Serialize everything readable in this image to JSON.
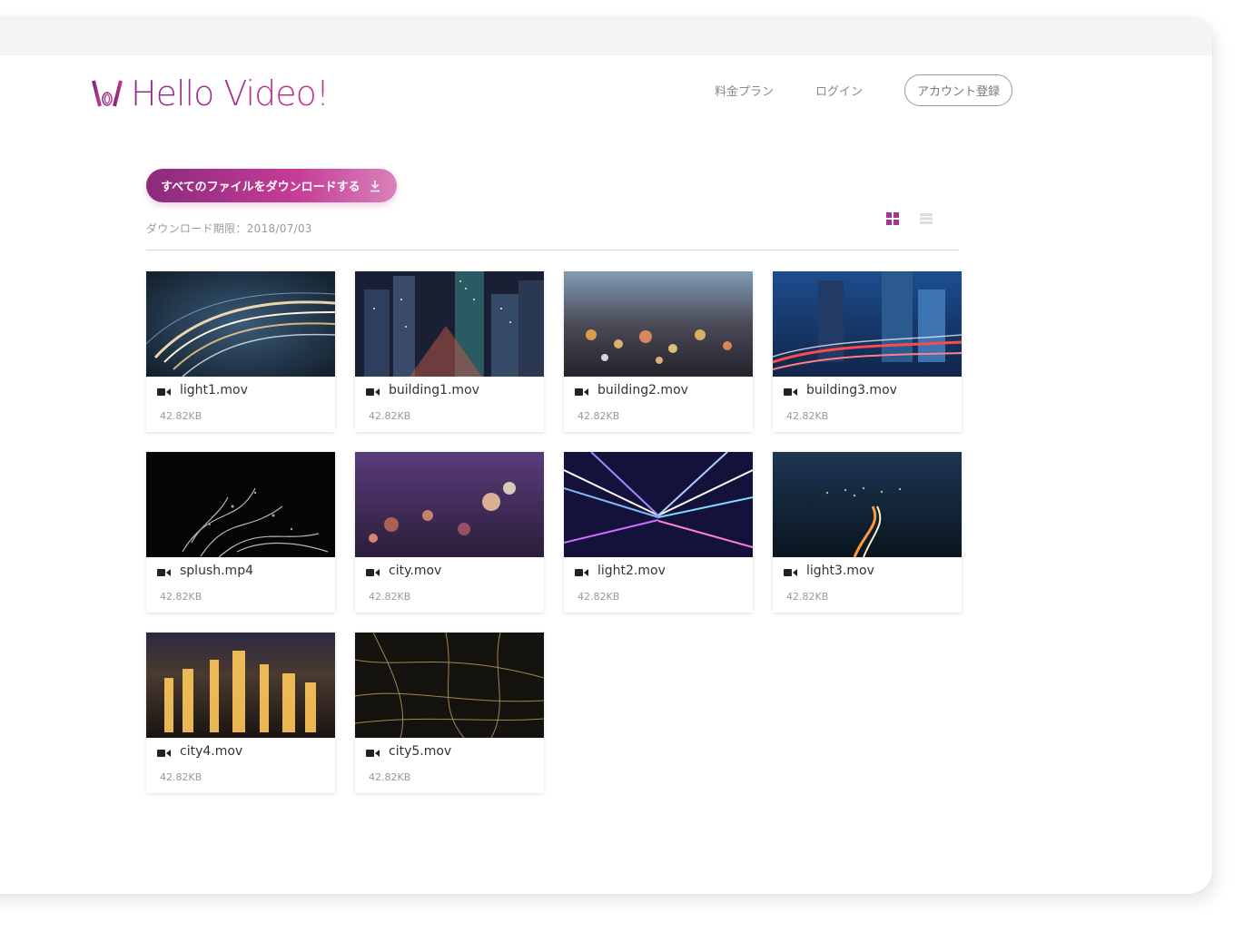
{
  "header": {
    "logo_text": "Hello Video!",
    "nav": {
      "pricing": "料金プラン",
      "login": "ログイン",
      "signup": "アカウント登録"
    }
  },
  "main": {
    "download_all_label": "すべてのファイルをダウンロードする",
    "deadline": "ダウンロード期限：2018/07/03"
  },
  "files": [
    {
      "name": "light1.mov",
      "size": "42.82KB",
      "thumb": "light-trails"
    },
    {
      "name": "building1.mov",
      "size": "42.82KB",
      "thumb": "city-night-buildings"
    },
    {
      "name": "building2.mov",
      "size": "42.82KB",
      "thumb": "bokeh-city"
    },
    {
      "name": "building3.mov",
      "size": "42.82KB",
      "thumb": "skyscrapers-blue"
    },
    {
      "name": "splush.mp4",
      "size": "42.82KB",
      "thumb": "water-splash"
    },
    {
      "name": "city.mov",
      "size": "42.82KB",
      "thumb": "purple-bokeh-city"
    },
    {
      "name": "light2.mov",
      "size": "42.82KB",
      "thumb": "light-tunnel"
    },
    {
      "name": "light3.mov",
      "size": "42.82KB",
      "thumb": "night-highway"
    },
    {
      "name": "city4.mov",
      "size": "42.82KB",
      "thumb": "golden-city"
    },
    {
      "name": "city5.mov",
      "size": "42.82KB",
      "thumb": "aerial-city-lights"
    }
  ],
  "colors": {
    "brand": "#b3308a",
    "brand_dark": "#8b2a7c"
  }
}
